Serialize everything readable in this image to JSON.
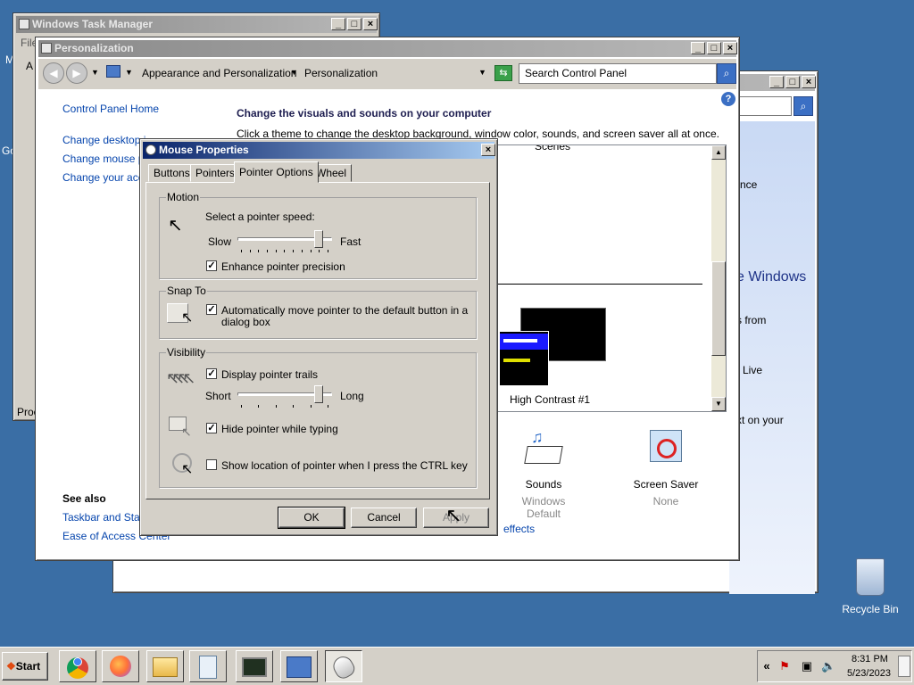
{
  "desktop": {
    "recycle_bin_label": "Recycle Bin",
    "left_edge_m": "M",
    "left_edge_go": "Go"
  },
  "task_manager": {
    "title": "Windows Task Manager",
    "menu_file": "File",
    "tab_letter": "A",
    "status_text": "Proc"
  },
  "back_window": {
    "text_ance": "nce",
    "heading_windows": "e Windows",
    "text_from": "s from",
    "text_live": "Live",
    "text_on_your": "xt on your"
  },
  "personalization": {
    "title": "Personalization",
    "breadcrumb": {
      "crumb1": "Appearance and Personalization",
      "crumb2": "Personalization"
    },
    "search_placeholder": "Search Control Panel",
    "help_icon": "?",
    "sidebar": {
      "home": "Control Panel Home",
      "change_desktop": "Change desktop i",
      "change_mouse": "Change mouse po",
      "change_account": "Change your acco",
      "see_also": "See also",
      "taskbar": "Taskbar and Start",
      "ease": "Ease of Access Center"
    },
    "main": {
      "heading": "Change the visuals and sounds on your computer",
      "subtext": "Click a theme to change the desktop background, window color, sounds, and screen saver all at once.",
      "scenes_label": "Scenes",
      "theme_name": "High Contrast #1",
      "sounds_label": "Sounds",
      "sounds_value": "Windows Default",
      "screensaver_label": "Screen Saver",
      "screensaver_value": "None",
      "effects_link": "effects"
    }
  },
  "mouse_properties": {
    "title": "Mouse Properties",
    "tabs": [
      "Buttons",
      "Pointers",
      "Pointer Options",
      "Wheel"
    ],
    "selected_tab": "Pointer Options",
    "motion": {
      "label": "Motion",
      "prompt": "Select a pointer speed:",
      "slow": "Slow",
      "fast": "Fast",
      "speed_fraction": 0.9,
      "enhance_label": "Enhance pointer precision",
      "enhance_checked": true
    },
    "snap_to": {
      "label": "Snap To",
      "auto_line1": "Automatically move pointer to the default button in a",
      "auto_line2": "dialog box",
      "auto_checked": true
    },
    "visibility": {
      "label": "Visibility",
      "trails_label": "Display pointer trails",
      "trails_checked": true,
      "short": "Short",
      "long": "Long",
      "trail_fraction": 0.9,
      "hide_label": "Hide pointer while typing",
      "hide_checked": true,
      "ctrl_label": "Show location of pointer when I press the CTRL key",
      "ctrl_checked": false
    },
    "buttons": {
      "ok": "OK",
      "cancel": "Cancel",
      "apply": "Apply"
    }
  },
  "taskbar": {
    "start": "Start",
    "tray_chevron": "«",
    "time": "8:31 PM",
    "date": "5/23/2023"
  },
  "colors": {
    "desktop": "#3a6ea5",
    "active_title": "#0a246a",
    "link": "#0645ad"
  }
}
